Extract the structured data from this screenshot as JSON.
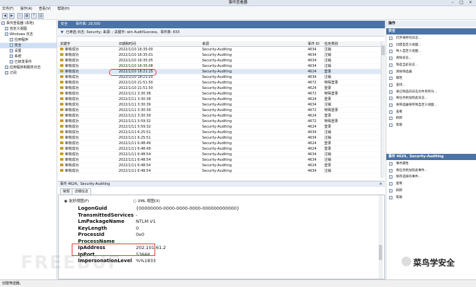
{
  "window": {
    "title": "事件查看器"
  },
  "menu": [
    "文件(F)",
    "操作(A)",
    "查看(V)",
    "帮助(H)"
  ],
  "tree": [
    {
      "label": "事件查看器 (本地)"
    },
    {
      "label": "自定义视图"
    },
    {
      "label": "Windows 日志"
    },
    {
      "label": "应用程序"
    },
    {
      "label": "安全"
    },
    {
      "label": "设置"
    },
    {
      "label": "系统"
    },
    {
      "label": "已转发事件"
    },
    {
      "label": "应用程序和服务日志"
    },
    {
      "label": "订阅"
    }
  ],
  "center": {
    "log_name": "安全",
    "event_count": "事件数: 28,500",
    "filter_text": "已筛选:日志: Security; 来源: ; 关键字: win AuditSuccess。事件数: 833"
  },
  "columns": [
    "关键字",
    "日期和时间",
    "来源",
    "事件 ID",
    "任务类别"
  ],
  "rows": [
    [
      "审核成功",
      "2022/1/10 16:35:00",
      "Security-Auditing",
      "4634",
      "注销"
    ],
    [
      "审核成功",
      "2022/1/10 16:35:01",
      "Security-Auditing",
      "4634",
      "注销"
    ],
    [
      "审核成功",
      "2022/1/10 16:35:05",
      "Security-Auditing",
      "4634",
      "注销"
    ],
    [
      "审核成功",
      "2022/1/10 16:35:08",
      "Security-Auditing",
      "4634",
      "注销"
    ],
    [
      "审核成功",
      "2022/1/10 18:21:25",
      "Security-Auditing",
      "4624",
      "登录"
    ],
    [
      "审核成功",
      "2022/1/10 18:21:25",
      "Security-Auditing",
      "4634",
      "注销"
    ],
    [
      "审核成功",
      "2022/1/10 21:51:50",
      "Security-Auditing",
      "4672",
      "特殊登录"
    ],
    [
      "审核成功",
      "2022/1/10 21:51:50",
      "Security-Auditing",
      "4624",
      "登录"
    ],
    [
      "审核成功",
      "2022/1/11 3:30:38",
      "Security-Auditing",
      "4672",
      "特殊登录"
    ],
    [
      "审核成功",
      "2022/1/11 3:30:38",
      "Security-Auditing",
      "4624",
      "登录"
    ],
    [
      "审核成功",
      "2022/1/11 3:30:39",
      "Security-Auditing",
      "4634",
      "注销"
    ],
    [
      "审核成功",
      "2022/1/11 3:30:39",
      "Security-Auditing",
      "4672",
      "特殊登录"
    ],
    [
      "审核成功",
      "2022/1/11 3:30:39",
      "Security-Auditing",
      "4624",
      "登录"
    ],
    [
      "审核成功",
      "2022/1/11 5:59:32",
      "Security-Auditing",
      "4672",
      "特殊登录"
    ],
    [
      "审核成功",
      "2022/1/11 5:59:32",
      "Security-Auditing",
      "4624",
      "登录"
    ],
    [
      "审核成功",
      "2022/1/11 6:25:51",
      "Security-Auditing",
      "4634",
      "注销"
    ],
    [
      "审核成功",
      "2022/1/11 6:25:51",
      "Security-Auditing",
      "4634",
      "注销"
    ],
    [
      "审核成功",
      "2022/1/11 6:48:49",
      "Security-Auditing",
      "4624",
      "登录"
    ],
    [
      "审核成功",
      "2022/1/11 6:48:49",
      "Security-Auditing",
      "4624",
      "登录"
    ],
    [
      "审核成功",
      "2022/1/11 6:48:54",
      "Security-Auditing",
      "4634",
      "注销"
    ],
    [
      "审核成功",
      "2022/1/11 6:48:54",
      "Security-Auditing",
      "4634",
      "注销"
    ],
    [
      "审核成功",
      "2022/1/11 6:48:54",
      "Security-Auditing",
      "4624",
      "登录"
    ],
    [
      "审核成功",
      "2022/1/11 6:48:54",
      "Security-Auditing",
      "4634",
      "注销"
    ]
  ],
  "detail": {
    "header": "事件 4624，Security-Auditing",
    "tabs": [
      "常规",
      "详细信息"
    ],
    "view_friendly": "友好视图(F)",
    "view_xml": "XML 视图(X)",
    "fields": [
      {
        "name": "LogonGuid",
        "value": "{00000000-0000-0000-0000-000000000000}"
      },
      {
        "name": "TransmittedServices",
        "value": "-"
      },
      {
        "name": "LmPackageName",
        "value": "NTLM V1"
      },
      {
        "name": "KeyLength",
        "value": "0"
      },
      {
        "name": "ProcessId",
        "value": "0x0"
      },
      {
        "name": "ProcessName",
        "value": ""
      },
      {
        "name": "IpAddress",
        "value": "202.101.61.2"
      },
      {
        "name": "IpPort",
        "value": "53666"
      },
      {
        "name": "ImpersonationLevel",
        "value": "%%1833"
      }
    ]
  },
  "actions": {
    "title": "操作",
    "section1": "安全",
    "items1": [
      "打开保存的日志...",
      "创建自定义视图...",
      "导入自定义视图...",
      "清除日志...",
      "筛选当前日志...",
      "清除筛选器",
      "属性",
      "查找...",
      "将已筛选的日志文件另存为...",
      "将任务附加到此日志...",
      "将筛选器保存到自定义视图...",
      "查看",
      "刷新",
      "帮助"
    ],
    "section2": "事件 4624，Security-Auditing",
    "items2": [
      "事件属性",
      "将任务附加到此事件...",
      "保存选择的事件...",
      "复制",
      "刷新",
      "帮助"
    ]
  },
  "status": {
    "text": "创建筛选器。"
  },
  "watermark": {
    "left": "FREEBUF",
    "right": "菜鸟学安全"
  },
  "colors": {
    "accent": "#4a73a6",
    "highlight": "#e03b2f"
  }
}
